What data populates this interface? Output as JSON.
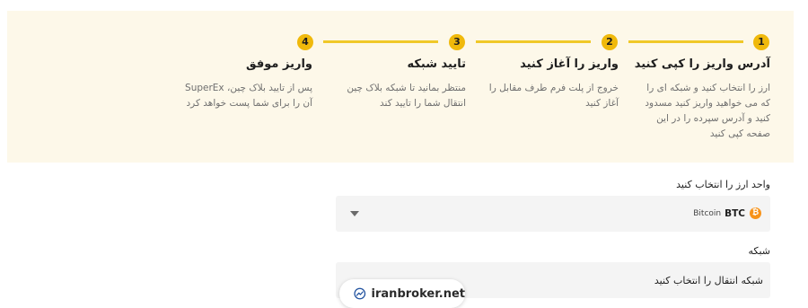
{
  "header": {
    "close_icon": "close-icon"
  },
  "steps": [
    {
      "number": "1",
      "title": "آدرس واریز را کپی کنید",
      "desc_lines": [
        "ارز را انتخاب کنید و شبکه ای را",
        "که می خواهید واریز کنید مسدود",
        "کنید و آدرس سپرده را در این",
        "صفحه کپی کنید"
      ]
    },
    {
      "number": "2",
      "title": "واریز را آغاز کنید",
      "desc_lines": [
        "خروج از پلت فرم طرف مقابل را",
        "آغاز کنید"
      ]
    },
    {
      "number": "3",
      "title": "تایید شبکه",
      "desc_lines": [
        "منتظر بمانید تا شبکه بلاک چین",
        "انتقال شما را تایید کند"
      ]
    },
    {
      "number": "4",
      "title": "واریز موفق",
      "desc_lines": [
        "پس از تایید بلاک چین، SuperEx",
        "آن را برای شما پست خواهد کرد"
      ]
    }
  ],
  "currency": {
    "label": "واحد ارز را انتخاب کنید",
    "selected_symbol": "BTC",
    "selected_name": "Bitcoin",
    "icon": "bitcoin-icon"
  },
  "network": {
    "label": "شبکه",
    "placeholder": "شبکه انتقال را انتخاب کنید"
  },
  "watermark": {
    "text": "iranbroker.net",
    "icon": "chart-trend-icon"
  },
  "colors": {
    "accent": "#f0b90b",
    "panel_bg": "#fdf8e9",
    "select_bg": "#f4f4f4"
  }
}
